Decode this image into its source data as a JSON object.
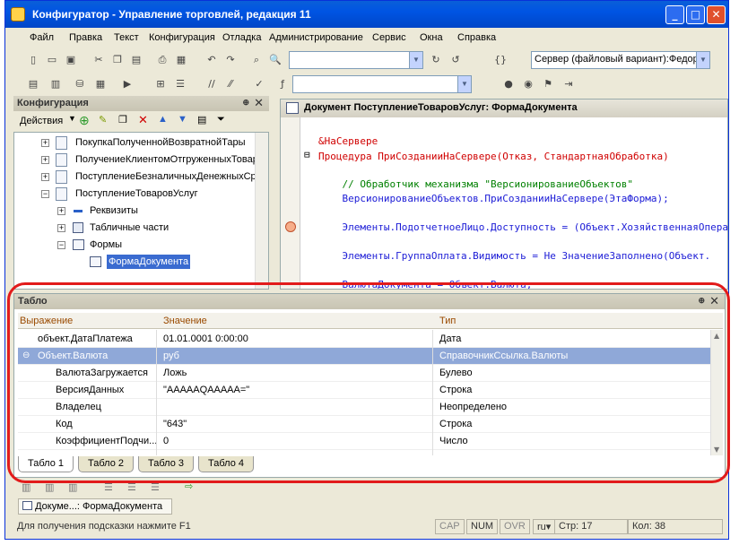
{
  "window": {
    "title": "Конфигуратор - Управление торговлей, редакция 11"
  },
  "menu": [
    "Файл",
    "Правка",
    "Текст",
    "Конфигурация",
    "Отладка",
    "Администрирование",
    "Сервис",
    "Окна",
    "Справка"
  ],
  "toolbar": {
    "server_combo": "Сервер (файловый вариант):Федор"
  },
  "config_panel": {
    "title": "Конфигурация",
    "actions_label": "Действия",
    "tree": [
      {
        "label": "ПокупкаПолученнойВозвратнойТары",
        "level": 1,
        "expander": "+"
      },
      {
        "label": "ПолучениеКлиентомОтгруженныхТоваров",
        "level": 1,
        "expander": "+"
      },
      {
        "label": "ПоступлениеБезналичныхДенежныхСредств",
        "level": 1,
        "expander": "+"
      },
      {
        "label": "ПоступлениеТоваровУслуг",
        "level": 1,
        "expander": "−"
      },
      {
        "label": "Реквизиты",
        "level": 2,
        "expander": "+"
      },
      {
        "label": "Табличные части",
        "level": 2,
        "expander": "+"
      },
      {
        "label": "Формы",
        "level": 2,
        "expander": "−"
      },
      {
        "label": "ФормаДокумента",
        "level": 3,
        "expander": ""
      }
    ]
  },
  "editor": {
    "title": "Документ ПоступлениеТоваровУслуг: ФормаДокумента",
    "lines": [
      {
        "text": "&НаСервере",
        "kind": "kw"
      },
      {
        "text": "Процедура ПриСозданииНаСервере(Отказ, СтандартнаяОбработка)",
        "kind": "mixed"
      },
      {
        "text": "    // Обработчик механизма \"ВерсионированиеОбъектов\"",
        "kind": "cm"
      },
      {
        "text": "    ВерсионированиеОбъектов.ПриСозданииНаСервере(ЭтаФорма);",
        "kind": "id"
      },
      {
        "text": "    Элементы.ПодотчетноеЛицо.Доступность = (Объект.ХозяйственнаяОперация",
        "kind": "id"
      },
      {
        "text": "    Элементы.ГруппаОплата.Видимость = Не ЗначениеЗаполнено(Объект.",
        "kind": "id"
      },
      {
        "text": "    ВалютаДокумента = Объект.Валюта;",
        "kind": "id"
      }
    ]
  },
  "table_panel": {
    "title": "Табло",
    "columns": [
      "Выражение",
      "Значение",
      "Тип"
    ],
    "rows": [
      {
        "expr": "объект.ДатаПлатежа",
        "value": "01.01.0001 0:00:00",
        "type": "Дата",
        "indent": 1,
        "expander": ""
      },
      {
        "expr": "Объект.Валюта",
        "value": "руб",
        "type": "СправочникСсылка.Валюты",
        "indent": 0,
        "expander": "−"
      },
      {
        "expr": "ВалютаЗагружается",
        "value": "Ложь",
        "type": "Булево",
        "indent": 2,
        "expander": ""
      },
      {
        "expr": "ВерсияДанных",
        "value": "\"AAAAAQAAAAA=\"",
        "type": "Строка",
        "indent": 2,
        "expander": ""
      },
      {
        "expr": "Владелец",
        "value": "",
        "type": "Неопределено",
        "indent": 2,
        "expander": ""
      },
      {
        "expr": "Код",
        "value": "\"643\"",
        "type": "Строка",
        "indent": 2,
        "expander": ""
      },
      {
        "expr": "КоэффициентПодчи...",
        "value": "0",
        "type": "Число",
        "indent": 2,
        "expander": ""
      }
    ],
    "tabs": [
      "Табло 1",
      "Табло 2",
      "Табло 3",
      "Табло 4"
    ]
  },
  "taskbar": {
    "doc_tab": "Докуме...: ФормаДокумента"
  },
  "status": {
    "hint": "Для получения подсказки нажмите F1",
    "cap": "CAP",
    "num": "NUM",
    "ovr": "OVR",
    "lang": "ru",
    "line": "Стр: 17",
    "col": "Кол: 38"
  }
}
